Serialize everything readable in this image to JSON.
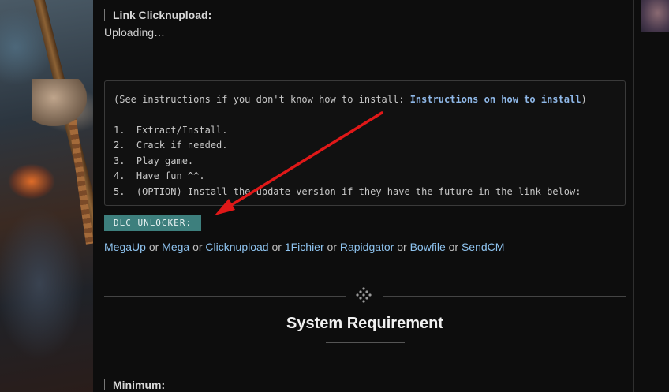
{
  "sections": {
    "link_heading": "Link Clicknupload:",
    "uploading_text": "Uploading…",
    "minimum_heading": "Minimum:"
  },
  "instructions": {
    "prefix": "(See instructions if you don't know how to install: ",
    "link_label": "Instructions on how to install",
    "suffix": ")",
    "steps": [
      "1.  Extract/Install.",
      "2.  Crack if needed.",
      "3.  Play game.",
      "4.  Have fun ^^.",
      "5.  (OPTION) Install the update version if they have the future in the link below:"
    ]
  },
  "dlc_badge": "DLC UNLOCKER:",
  "download_links": {
    "separator": "or",
    "items": [
      "MegaUp",
      "Mega",
      "Clicknupload",
      "1Fichier",
      "Rapidgator",
      "Bowfile",
      "SendCM"
    ]
  },
  "system_requirement_title": "System Requirement",
  "colors": {
    "background": "#0d0d0d",
    "link": "#8ec3ef",
    "badge": "#3d7f7d",
    "arrow": "#e01818"
  },
  "icons": {
    "divider": "diamond-dots-icon"
  }
}
